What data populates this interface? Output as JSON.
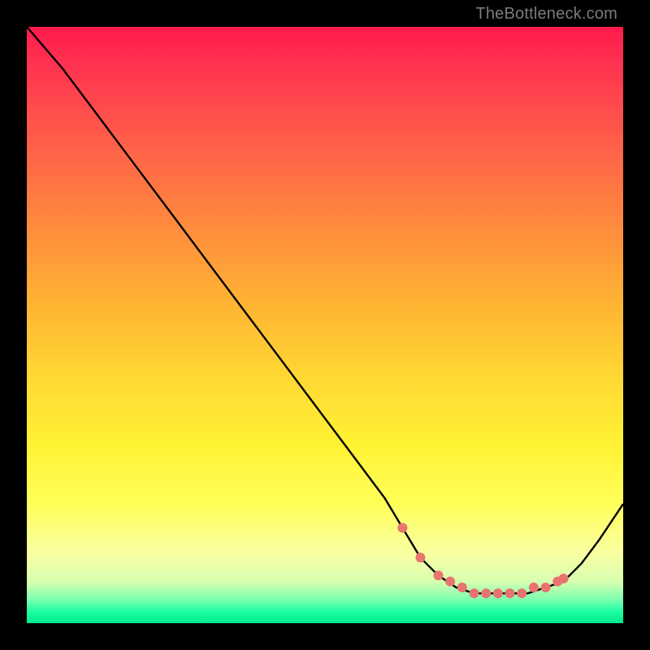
{
  "watermark": "TheBottleneck.com",
  "colors": {
    "background": "#000000",
    "curve_stroke": "#000000",
    "marker_fill": "#e9736f",
    "marker_stroke": "#000000"
  },
  "chart_data": {
    "type": "line",
    "title": "",
    "xlabel": "",
    "ylabel": "",
    "xlim": [
      0,
      100
    ],
    "ylim": [
      0,
      100
    ],
    "grid": false,
    "legend": false,
    "series": [
      {
        "name": "curve",
        "x": [
          0,
          6,
          12,
          18,
          24,
          30,
          36,
          42,
          48,
          54,
          60,
          63,
          66,
          69,
          72,
          75,
          78,
          81,
          84,
          87,
          90,
          93,
          96,
          100
        ],
        "y": [
          100,
          93,
          85,
          77,
          69,
          61,
          53,
          45,
          37,
          29,
          21,
          16,
          11,
          8,
          6,
          5,
          5,
          5,
          5,
          6,
          7,
          10,
          14,
          20
        ]
      }
    ],
    "markers": {
      "series": "curve",
      "x": [
        63,
        66,
        69,
        71,
        73,
        75,
        77,
        79,
        81,
        83,
        85,
        87,
        89,
        90
      ],
      "y": [
        16,
        11,
        8,
        7,
        6,
        5,
        5,
        5,
        5,
        5,
        6,
        6,
        7,
        7.5
      ]
    }
  }
}
